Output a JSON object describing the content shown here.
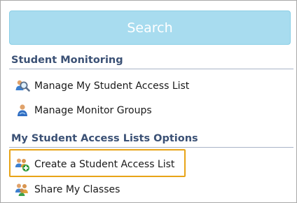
{
  "search": {
    "label": "Search"
  },
  "sections": [
    {
      "header": "Student Monitoring",
      "items": [
        {
          "label": "Manage My Student Access List",
          "icon": "magnifier-users-icon"
        },
        {
          "label": "Manage Monitor Groups",
          "icon": "monitor-group-icon"
        }
      ]
    },
    {
      "header": "My Student Access Lists Options",
      "items": [
        {
          "label": "Create a Student Access List",
          "icon": "add-users-icon"
        },
        {
          "label": "Share My Classes",
          "icon": "share-users-icon"
        }
      ]
    }
  ],
  "colors": {
    "search_bg": "#a8dcef",
    "header_text": "#3b5175",
    "highlight": "#e8a417"
  }
}
